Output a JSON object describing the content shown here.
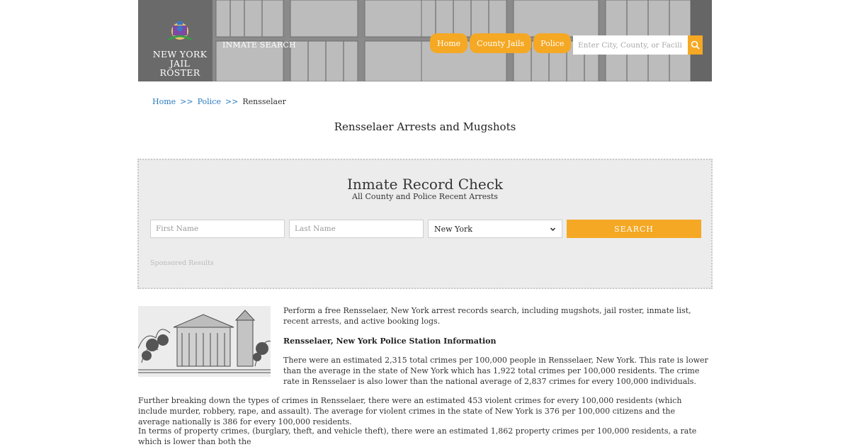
{
  "header": {
    "logo_line1": "NEW YORK",
    "logo_line2": "JAIL ROSTER",
    "inmate_search": "INMATE SEARCH",
    "nav": [
      "Home",
      "County Jails",
      "Police"
    ],
    "search_placeholder": "Enter City, County, or Facility",
    "accent": "#f5a823"
  },
  "breadcrumb": {
    "home": "Home",
    "sep": ">>",
    "police": "Police",
    "current": "Rensselaer"
  },
  "page_title": "Rensselaer Arrests and Mugshots",
  "record_check": {
    "title": "Inmate Record Check",
    "subtitle": "All County and Police Recent Arrests",
    "first_name_placeholder": "First Name",
    "last_name_placeholder": "Last Name",
    "state_selected": "New York",
    "search_label": "SEARCH",
    "sponsored": "Sponsored Results"
  },
  "content": {
    "intro": "Perform a free Rensselaer, New York arrest records search, including mugshots, jail roster, inmate list, recent arrests, and active booking logs.",
    "station_heading": "Rensselaer, New York Police Station Information",
    "crime_rate": "There were an estimated 2,315 total crimes per 100,000 people in Rensselaer, New York. This rate is lower than the average in the state of New York which has 1,922 total crimes per 100,000 residents. The crime rate in Rensselaer is also lower than the national average of 2,837 crimes for every 100,000 individuals.",
    "violent": "Further breaking down the types of crimes in Rensselaer, there were an estimated 453 violent crimes for every 100,000 residents (which include murder, robbery, rape, and assault). The average for violent crimes in the state of New York is 376 per 100,000 citizens and the average nationally is 386 for every 100,000 residents.",
    "property": "In terms of property crimes, (burglary, theft, and vehicle theft), there were an estimated 1,862 property crimes per 100,000 residents, a rate which is lower than both the"
  }
}
